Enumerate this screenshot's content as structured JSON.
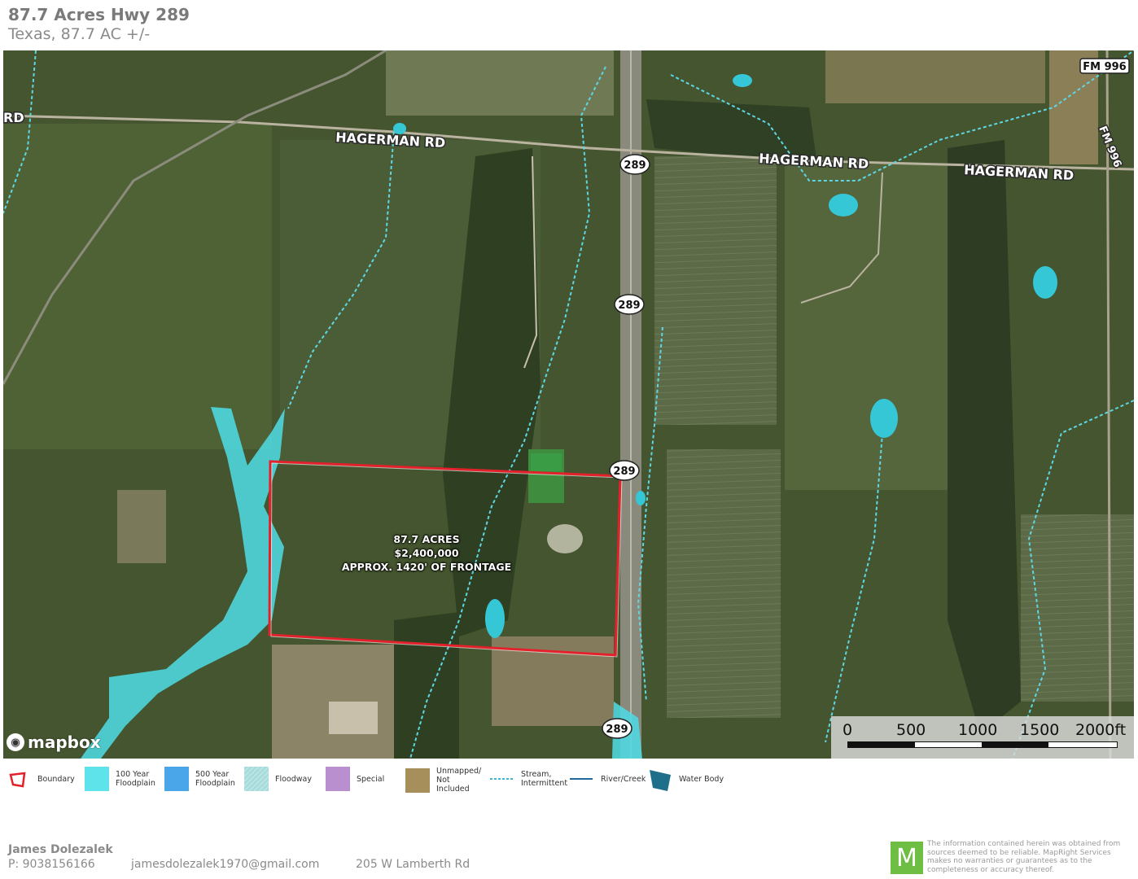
{
  "header": {
    "title": "87.7 Acres Hwy 289",
    "subtitle": "Texas, 87.7 AC +/-"
  },
  "map": {
    "roads": {
      "rd_left": "RD",
      "hagerman_1": "HAGERMAN RD",
      "hagerman_2": "HAGERMAN RD",
      "hagerman_3": "HAGERMAN RD",
      "fm996_top": "FM 996",
      "fm996_side": "FM 996"
    },
    "shields": [
      "289",
      "289",
      "289",
      "289"
    ],
    "parcel": {
      "line1": "87.7 ACRES",
      "line2": "$2,400,000",
      "line3": "APPROX. 1420' OF FRONTAGE",
      "boundary_color": "#e4202a"
    },
    "attribution": "mapbox",
    "scale": {
      "labels": [
        "0",
        "500",
        "1000",
        "1500",
        "2000ft"
      ]
    }
  },
  "legend": [
    {
      "icon": "boundary-icon",
      "label": "Boundary"
    },
    {
      "icon": "floodplain-100-swatch",
      "label": "100 Year Floodplain",
      "color": "#5ee3ea"
    },
    {
      "icon": "floodplain-500-swatch",
      "label": "500 Year Floodplain",
      "color": "#4aa6e8"
    },
    {
      "icon": "floodway-swatch",
      "label": "Floodway",
      "color": "#a8dcdc"
    },
    {
      "icon": "special-swatch",
      "label": "Special",
      "color": "#b98fd0"
    },
    {
      "icon": "unmapped-swatch",
      "label": "Unmapped/ Not Included",
      "color": "#a68f5a"
    },
    {
      "icon": "stream-icon",
      "label": "Stream, Intermittent",
      "color": "#3fb7d0"
    },
    {
      "icon": "river-icon",
      "label": "River/Creek",
      "color": "#1f6a9a"
    },
    {
      "icon": "water-body-icon",
      "label": "Water Body",
      "color": "#1f6f8a"
    }
  ],
  "footer": {
    "name": "James Dolezalek",
    "phone": "P: 9038156166",
    "email": "jamesdolezalek1970@gmail.com",
    "address": "205 W Lamberth Rd",
    "logo_letter": "M",
    "disclaimer": "The information contained herein was obtained from sources deemed to be reliable. MapRight Services makes no warranties or guarantees as to the completeness or accuracy thereof."
  }
}
